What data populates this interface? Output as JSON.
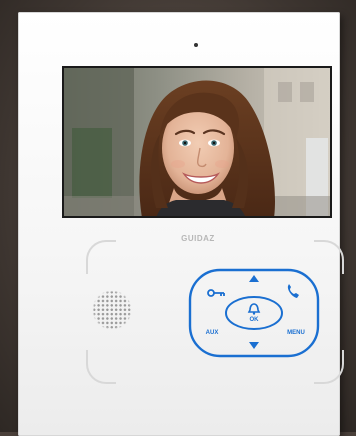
{
  "device": {
    "brand": "GUIDAZ",
    "keypad": {
      "aux_label": "AUX",
      "menu_label": "MENU",
      "ok_label": "OK"
    }
  },
  "colors": {
    "key_blue": "#1a6fd1",
    "device_white": "#f7f7f7",
    "wall": "#4a403a"
  },
  "icons": [
    "key-icon",
    "phone-handset-icon",
    "arrow-up-icon",
    "arrow-down-icon",
    "bell-icon"
  ]
}
